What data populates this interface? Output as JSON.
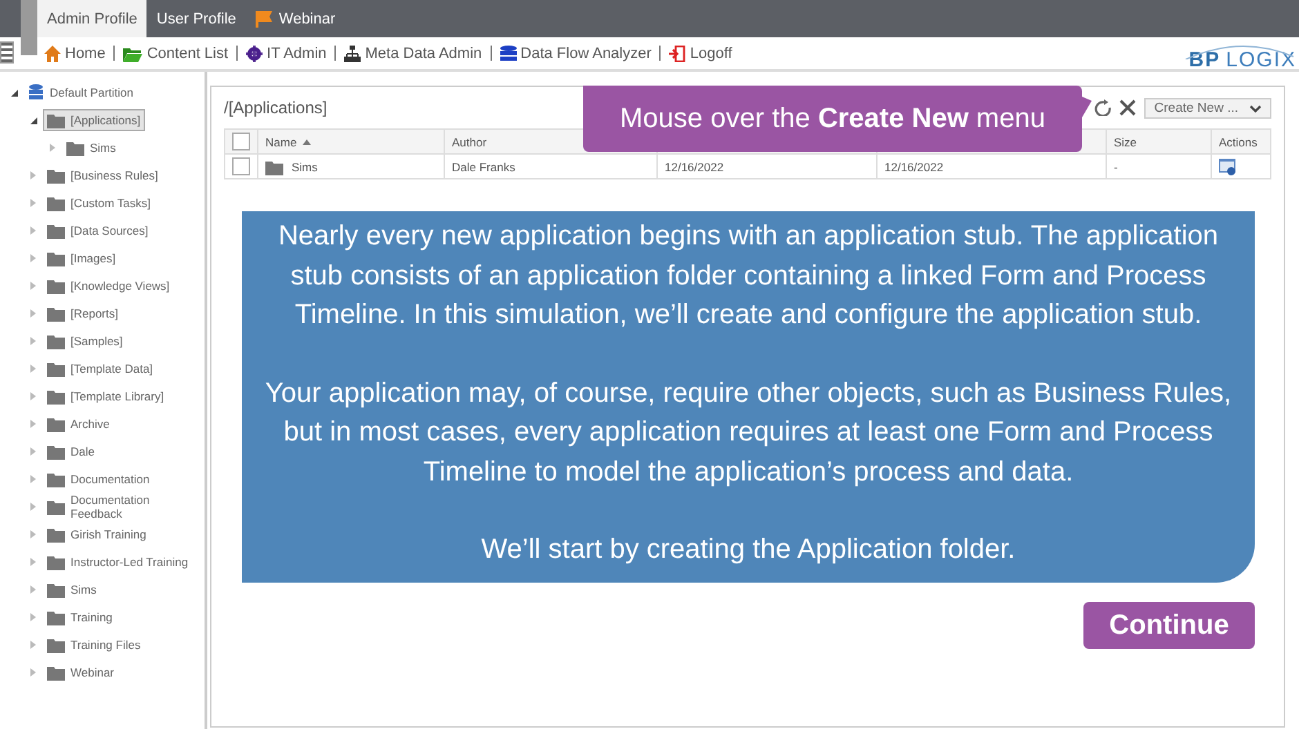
{
  "tabs": [
    {
      "label": "Admin Profile",
      "selected": true
    },
    {
      "label": "User Profile",
      "selected": false
    },
    {
      "label": "Webinar",
      "selected": false
    }
  ],
  "nav": [
    "Home",
    "Content List",
    "IT Admin",
    "Meta Data Admin",
    "Data Flow Analyzer",
    "Logoff"
  ],
  "logo": {
    "part_1": "BP",
    "part_2": "LOGIX"
  },
  "tree": [
    {
      "label": "Default Partition",
      "expanded": true,
      "selected": false,
      "children": [
        {
          "label": "[Applications]",
          "expanded": true,
          "selected": true,
          "children": [
            {
              "label": "Sims",
              "expanded": false,
              "selected": false
            }
          ]
        },
        {
          "label": "[Business Rules]",
          "expanded": false,
          "selected": false
        },
        {
          "label": "[Custom Tasks]",
          "expanded": false,
          "selected": false
        },
        {
          "label": "[Data Sources]",
          "expanded": false,
          "selected": false
        },
        {
          "label": "[Images]",
          "expanded": false,
          "selected": false
        },
        {
          "label": "[Knowledge Views]",
          "expanded": false,
          "selected": false
        },
        {
          "label": "[Reports]",
          "expanded": false,
          "selected": false
        },
        {
          "label": "[Samples]",
          "expanded": false,
          "selected": false
        },
        {
          "label": "[Template Data]",
          "expanded": false,
          "selected": false
        },
        {
          "label": "[Template Library]",
          "expanded": false,
          "selected": false
        },
        {
          "label": "Archive",
          "expanded": false,
          "selected": false
        },
        {
          "label": "Dale",
          "expanded": false,
          "selected": false
        },
        {
          "label": "Documentation",
          "expanded": false,
          "selected": false
        },
        {
          "label": "Documentation Feedback",
          "expanded": false,
          "selected": false
        },
        {
          "label": "Girish Training",
          "expanded": false,
          "selected": false
        },
        {
          "label": "Instructor-Led Training",
          "expanded": false,
          "selected": false
        },
        {
          "label": "Sims",
          "expanded": false,
          "selected": false
        },
        {
          "label": "Training",
          "expanded": false,
          "selected": false
        },
        {
          "label": "Training Files",
          "expanded": false,
          "selected": false
        },
        {
          "label": "Webinar",
          "expanded": false,
          "selected": false
        }
      ]
    }
  ],
  "content": {
    "path": "/[Applications]",
    "create_button": "Create New ...",
    "table": {
      "columns": [
        {
          "label": "Name",
          "sorted": true
        },
        {
          "label": "Author",
          "sorted": false
        },
        {},
        {},
        {
          "label": "Size",
          "sorted": false
        },
        {
          "label": "Actions",
          "sorted": false
        }
      ],
      "select_all": {
        "checked": false
      },
      "rows": [
        {
          "checked": false,
          "name": "Sims",
          "author": "Dale Franks",
          "column_3": "12/16/2022",
          "column_4": "12/16/2022",
          "size": "-"
        }
      ]
    }
  },
  "callout": "Mouse over the **Create New** menu",
  "tutorial": {
    "paragraphs": [
      "Nearly every new application begins with an application stub. The application stub consists of an application folder containing a linked Form and Process Timeline. In this simulation, we’ll create and configure the application stub.",
      "Your application may, of course, require other objects, such as Business Rules, but in most cases, every application requires at least one Form and Process Timeline to model the application’s process and data.",
      "We’ll start by creating the Application folder."
    ],
    "button": "Continue"
  }
}
